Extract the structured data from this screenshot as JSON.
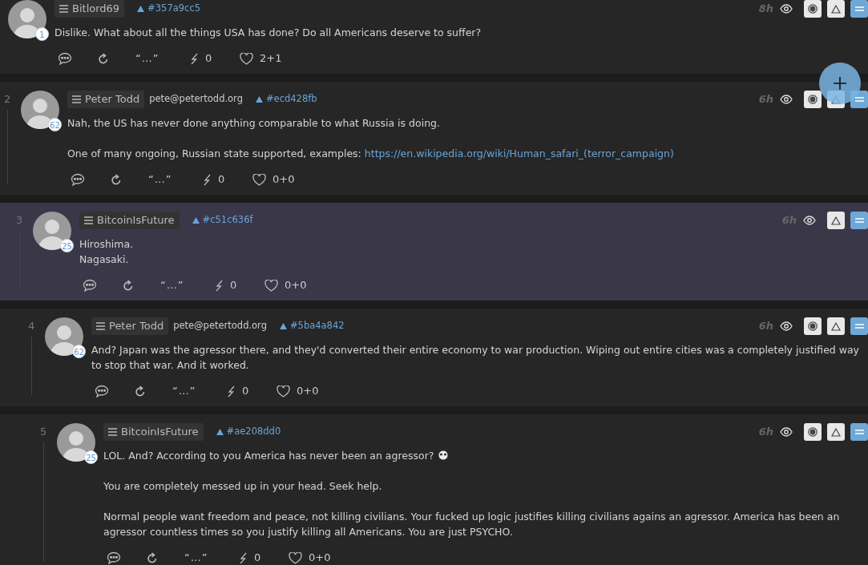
{
  "thread": {
    "author": "Bitlord69",
    "badge": "1",
    "hash": "#357a9cc5",
    "time": "8h",
    "buttons": [
      {
        "kind": "dot"
      },
      {
        "kind": "triangle"
      },
      {
        "kind": "equals"
      }
    ],
    "selected": false,
    "paragraphs": [
      {
        "text": "Dislike. What about all the things USA has done? Do all Americans deserve to suffer?"
      }
    ],
    "actions": {
      "quote": "“…”",
      "zaps": "0",
      "likes": "2+1"
    },
    "replies": [
      {
        "number": "2",
        "author": "Peter Todd",
        "email": "pete@petertodd.org",
        "badge": "62",
        "hash": "#ecd428fb",
        "time": "6h",
        "buttons": [
          {
            "kind": "dot"
          },
          {
            "kind": "triangle"
          },
          {
            "kind": "equals"
          }
        ],
        "selected": false,
        "paragraphs": [
          {
            "text": "Nah, the US has never done anything comparable to what Russia is doing."
          },
          {
            "text": "One of many ongoing, Russian state supported, examples: ",
            "link": "https://en.wikipedia.org/wiki/Human_safari_(terror_campaign)"
          }
        ],
        "actions": {
          "quote": "“…”",
          "zaps": "0",
          "likes": "0+0"
        },
        "replies": [
          {
            "number": "3",
            "author": "BitcoinIsFuture",
            "badge": "25",
            "hash": "#c51c636f",
            "time": "6h",
            "buttons": [
              {
                "kind": "triangle"
              },
              {
                "kind": "equals"
              }
            ],
            "selected": true,
            "paragraphs": [
              {
                "text": "Hiroshima.\nNagasaki."
              }
            ],
            "actions": {
              "quote": "“…”",
              "zaps": "0",
              "likes": "0+0"
            },
            "replies": [
              {
                "number": "4",
                "author": "Peter Todd",
                "email": "pete@petertodd.org",
                "badge": "62",
                "hash": "#5ba4a842",
                "time": "6h",
                "buttons": [
                  {
                    "kind": "dot"
                  },
                  {
                    "kind": "triangle"
                  },
                  {
                    "kind": "equals"
                  }
                ],
                "selected": false,
                "paragraphs": [
                  {
                    "text": "And? Japan was the agressor there, and they'd converted their entire economy to war production. Wiping out entire cities was a completely justified way to stop that war. And it worked."
                  }
                ],
                "actions": {
                  "quote": "“…”",
                  "zaps": "0",
                  "likes": "0+0"
                },
                "replies": [
                  {
                    "number": "5",
                    "author": "BitcoinIsFuture",
                    "badge": "25",
                    "hash": "#ae208dd0",
                    "time": "6h",
                    "buttons": [
                      {
                        "kind": "dot"
                      },
                      {
                        "kind": "triangle"
                      },
                      {
                        "kind": "equals"
                      }
                    ],
                    "selected": false,
                    "paragraphs": [
                      {
                        "text": "LOL. And? According to you America has never been an agressor?",
                        "emoji": true
                      },
                      {
                        "text": "You are completely messed up in your head. Seek help."
                      },
                      {
                        "text": "Normal people want freedom and peace, not killing civilians. Your fucked up logic justifies killing civilians agains an agressor. America has been an agressor countless times so you justify killing all Americans. You are just PSYCHO."
                      }
                    ],
                    "actions": {
                      "quote": "“…”",
                      "zaps": "0",
                      "likes": "0+0"
                    }
                  }
                ]
              }
            ]
          }
        ]
      }
    ]
  },
  "compose_button": true
}
